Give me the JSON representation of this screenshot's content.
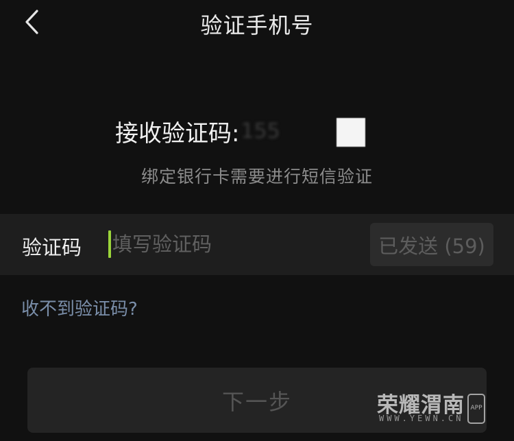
{
  "header": {
    "back_icon": "chevron-left-icon",
    "title": "验证手机号"
  },
  "verify": {
    "receive_label": "接收验证码:",
    "phone_number": "155",
    "hint": "绑定银行卡需要进行短信验证"
  },
  "code_row": {
    "label": "验证码",
    "placeholder": "填写验证码",
    "value": "",
    "resend_label": "已发送 (59)"
  },
  "links": {
    "no_code": "收不到验证码?"
  },
  "actions": {
    "next_label": "下一步"
  },
  "watermark": {
    "name": "荣耀渭南",
    "url": "WWW.YEWN.CN",
    "app_badge": "APP"
  },
  "colors": {
    "background": "#111111",
    "row_background": "#1e1e1e",
    "caret": "#9bd43a",
    "link": "#7a8ea9",
    "disabled_text": "#555555"
  }
}
